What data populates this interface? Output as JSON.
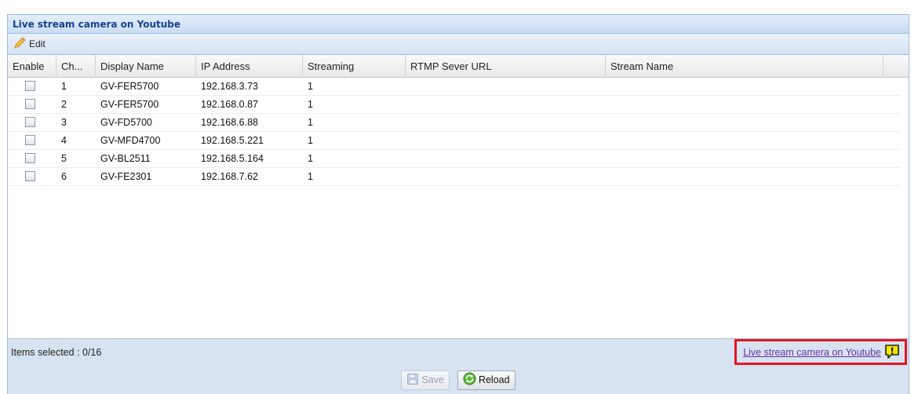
{
  "window": {
    "title": "Live stream camera on Youtube"
  },
  "toolbar": {
    "edit_label": "Edit"
  },
  "grid": {
    "columns": [
      "Enable",
      "Ch...",
      "Display Name",
      "IP Address",
      "Streaming",
      "RTMP Sever URL",
      "Stream Name"
    ],
    "rows": [
      {
        "ch": "1",
        "name": "GV-FER5700",
        "ip": "192.168.3.73",
        "streaming": "1",
        "rtmp": "",
        "stream": "",
        "enabled": false
      },
      {
        "ch": "2",
        "name": "GV-FER5700",
        "ip": "192.168.0.87",
        "streaming": "1",
        "rtmp": "",
        "stream": "",
        "enabled": false
      },
      {
        "ch": "3",
        "name": "GV-FD5700",
        "ip": "192.168.6.88",
        "streaming": "1",
        "rtmp": "",
        "stream": "",
        "enabled": false
      },
      {
        "ch": "4",
        "name": "GV-MFD4700",
        "ip": "192.168.5.221",
        "streaming": "1",
        "rtmp": "",
        "stream": "",
        "enabled": false
      },
      {
        "ch": "5",
        "name": "GV-BL2511",
        "ip": "192.168.5.164",
        "streaming": "1",
        "rtmp": "",
        "stream": "",
        "enabled": false
      },
      {
        "ch": "6",
        "name": "GV-FE2301",
        "ip": "192.168.7.62",
        "streaming": "1",
        "rtmp": "",
        "stream": "",
        "enabled": false
      }
    ]
  },
  "status": {
    "items_selected": "Items selected : 0/16",
    "link_label": "Live stream camera on Youtube"
  },
  "buttons": {
    "save_label": "Save",
    "reload_label": "Reload"
  },
  "icons": {
    "edit": "pencil-icon",
    "warning": "exclamation-icon",
    "save": "floppy-disk-icon",
    "reload": "refresh-icon"
  },
  "colors": {
    "header_text": "#15428b",
    "highlight_border": "#e3171e",
    "link": "#6a2fa0",
    "warning": "#f5e600"
  }
}
